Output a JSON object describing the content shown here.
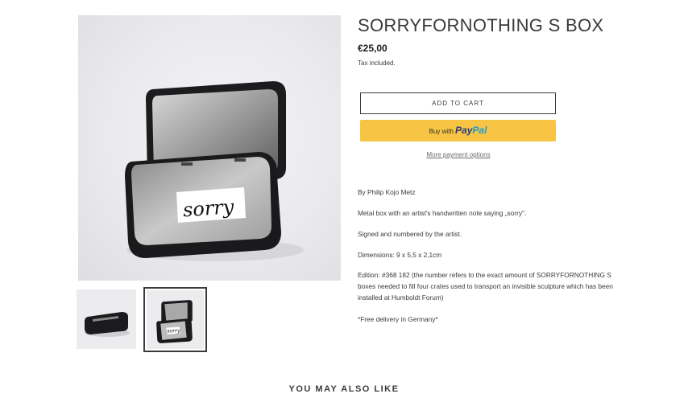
{
  "product": {
    "title": "SORRYFORNOTHING S BOX",
    "price": "€25,00",
    "tax_note": "Tax included."
  },
  "images": {
    "main_note_text": "sorry",
    "thumb_note_text": "sorry"
  },
  "actions": {
    "add_to_cart": "ADD TO CART",
    "paypal_prefix": "Buy with",
    "paypal_pay": "Pay",
    "paypal_pal": "Pal",
    "more_payment_options": "More payment options"
  },
  "description": {
    "author": "By Philip Kojo Metz",
    "summary": "Metal box with an artist's handwritten note saying „sorry\".",
    "signed": "Signed and numbered by the artist.",
    "dimensions": "Dimensions: 9 x 5,5 x 2,1cm",
    "edition": "Edition: #368 182 (the number refers to the exact amount of SORRYFORNOTHING S boxes needed to fill four crates used to transport an invisible sculpture which has been installed at Humboldt Forum)",
    "delivery": "*Free delivery in Germany*"
  },
  "recommendations": {
    "heading": "YOU MAY ALSO LIKE"
  },
  "colors": {
    "paypal_yellow": "#f7c443",
    "paypal_dark_blue": "#253b80",
    "paypal_light_blue": "#179bd7",
    "text": "#3a3a3a"
  }
}
